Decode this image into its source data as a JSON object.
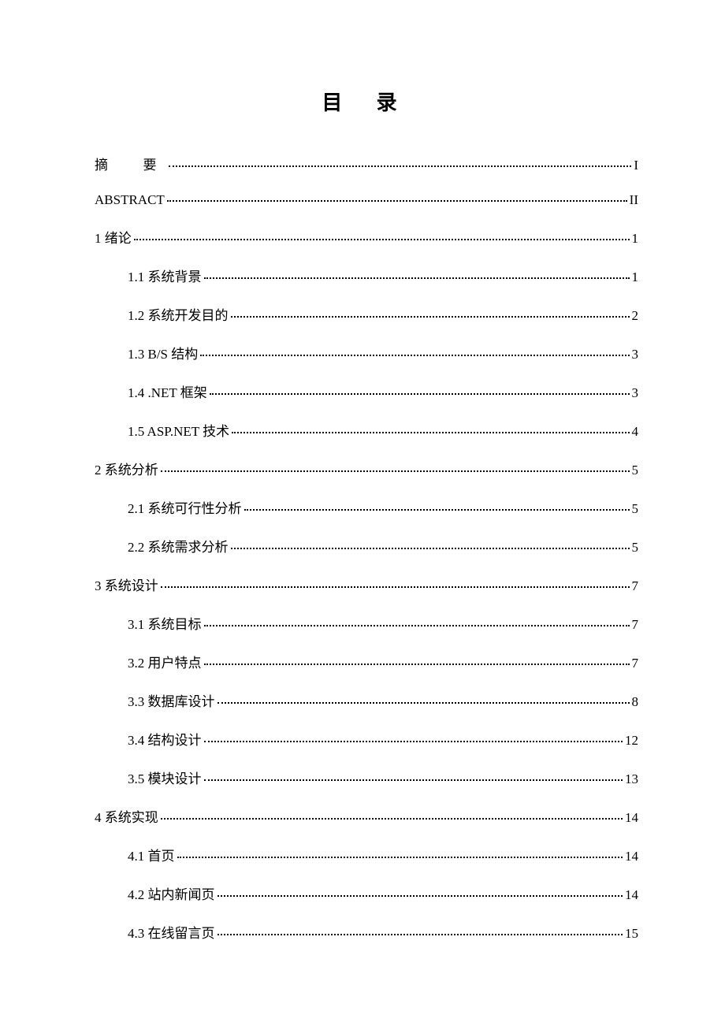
{
  "title": "目 录",
  "entries": [
    {
      "label": "摘  要",
      "page": "I",
      "level": 0,
      "wide": true
    },
    {
      "label": "ABSTRACT",
      "page": "II",
      "level": 0
    },
    {
      "label": "1 绪论",
      "page": "1",
      "level": 0
    },
    {
      "label": "1.1 系统背景",
      "page": "1",
      "level": 1
    },
    {
      "label": "1.2 系统开发目的",
      "page": "2",
      "level": 1
    },
    {
      "label": "1.3 B/S 结构",
      "page": "3",
      "level": 1
    },
    {
      "label": "1.4 .NET 框架",
      "page": "3",
      "level": 1
    },
    {
      "label": "1.5 ASP.NET 技术",
      "page": "4",
      "level": 1
    },
    {
      "label": "2 系统分析",
      "page": "5",
      "level": 0
    },
    {
      "label": "2.1 系统可行性分析",
      "page": "5",
      "level": 1
    },
    {
      "label": "2.2 系统需求分析",
      "page": "5",
      "level": 1
    },
    {
      "label": "3 系统设计",
      "page": "7",
      "level": 0
    },
    {
      "label": "3.1 系统目标",
      "page": "7",
      "level": 1
    },
    {
      "label": "3.2 用户特点",
      "page": "7",
      "level": 1
    },
    {
      "label": "3.3 数据库设计",
      "page": "8",
      "level": 1
    },
    {
      "label": "3.4 结构设计",
      "page": "12",
      "level": 1
    },
    {
      "label": "3.5 模块设计",
      "page": "13",
      "level": 1
    },
    {
      "label": "4 系统实现",
      "page": "14",
      "level": 0
    },
    {
      "label": "4.1 首页",
      "page": "14",
      "level": 1
    },
    {
      "label": "4.2 站内新闻页",
      "page": "14",
      "level": 1
    },
    {
      "label": "4.3 在线留言页",
      "page": "15",
      "level": 1
    }
  ]
}
